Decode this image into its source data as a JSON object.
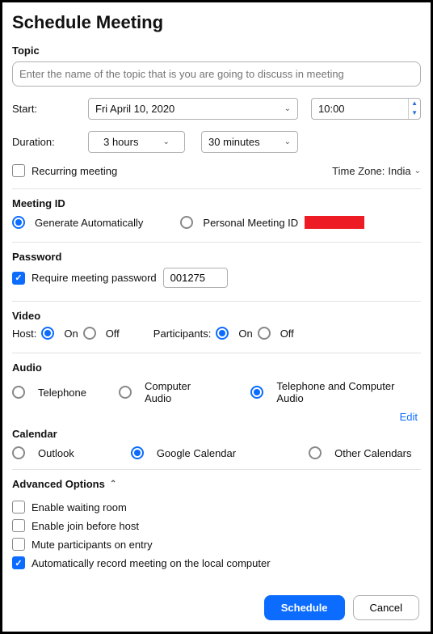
{
  "title": "Schedule Meeting",
  "topic": {
    "label": "Topic",
    "placeholder": "Enter the name of the topic that is you are going to discuss in meeting"
  },
  "start": {
    "label": "Start:",
    "date": "Fri  April 10, 2020",
    "time": "10:00"
  },
  "duration": {
    "label": "Duration:",
    "hours": "3 hours",
    "minutes": "30 minutes"
  },
  "recurring": {
    "label": "Recurring meeting",
    "checked": false
  },
  "timezone": {
    "prefix": "Time Zone: ",
    "value": "India"
  },
  "meetingId": {
    "heading": "Meeting ID",
    "generate": "Generate Automatically",
    "personal": "Personal Meeting ID",
    "selected": "generate"
  },
  "password": {
    "heading": "Password",
    "require": "Require meeting password",
    "checked": true,
    "value": "001275"
  },
  "video": {
    "heading": "Video",
    "hostLabel": "Host:",
    "participantsLabel": "Participants:",
    "on": "On",
    "off": "Off",
    "hostSelected": "on",
    "participantsSelected": "on"
  },
  "audio": {
    "heading": "Audio",
    "telephone": "Telephone",
    "computer": "Computer Audio",
    "both": "Telephone and Computer Audio",
    "selected": "both",
    "editLabel": "Edit"
  },
  "calendar": {
    "heading": "Calendar",
    "outlook": "Outlook",
    "google": "Google Calendar",
    "other": "Other Calendars",
    "selected": "google"
  },
  "advanced": {
    "heading": "Advanced Options",
    "waitingRoom": {
      "label": "Enable waiting room",
      "checked": false
    },
    "joinBefore": {
      "label": "Enable join before host",
      "checked": false
    },
    "muteEntry": {
      "label": "Mute participants on entry",
      "checked": false
    },
    "autoRecord": {
      "label": "Automatically record meeting on the local computer",
      "checked": true
    }
  },
  "buttons": {
    "schedule": "Schedule",
    "cancel": "Cancel"
  }
}
